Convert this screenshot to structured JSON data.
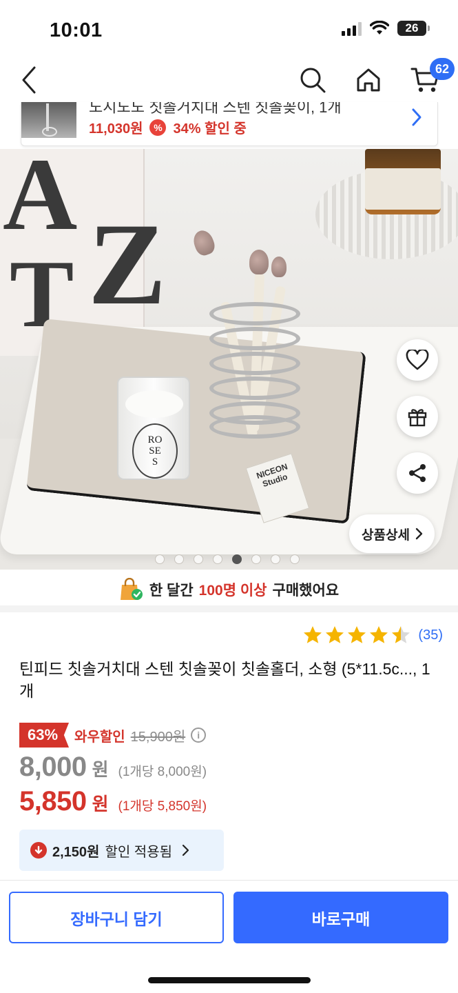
{
  "status_bar": {
    "time": "10:01",
    "battery": "26"
  },
  "nav": {
    "cart_count": "62"
  },
  "recent_banner": {
    "title": "노시노노 칫솔거치대 스텐 칫솔꽂이, 1개",
    "price": "11,030원",
    "discount_icon": "%",
    "discount_text": "34% 할인 중"
  },
  "image": {
    "detail_button": "상품상세",
    "slide_count": 8,
    "active_slide": 5
  },
  "purchase_notice": {
    "prefix": "한 달간",
    "highlight": "100명 이상",
    "suffix": "구매했어요"
  },
  "rating": {
    "value": 4.5,
    "review_count": "(35)"
  },
  "product": {
    "title": "틴피드 칫솔거치대 스텐 칫솔꽂이 칫솔홀더, 소형 (5*11.5c..., 1개"
  },
  "pricing": {
    "discount_badge": "63%",
    "wow_label": "와우할인",
    "original_price": "15,900원",
    "info_icon": "i",
    "base_price": "8,000",
    "base_won": "원",
    "base_unit": "(1개당 8,000원)",
    "sale_price": "5,850",
    "sale_won": "원",
    "sale_unit": "(1개당 5,850원)"
  },
  "discount_applied": {
    "amount": "2,150원",
    "text": "할인 적용됨"
  },
  "bottom_bar": {
    "cart_label": "장바구니 담기",
    "buy_label": "바로구매"
  },
  "colors": {
    "accent_blue": "#346aff",
    "sale_red": "#d4342b",
    "star_yellow": "#f5b400"
  }
}
